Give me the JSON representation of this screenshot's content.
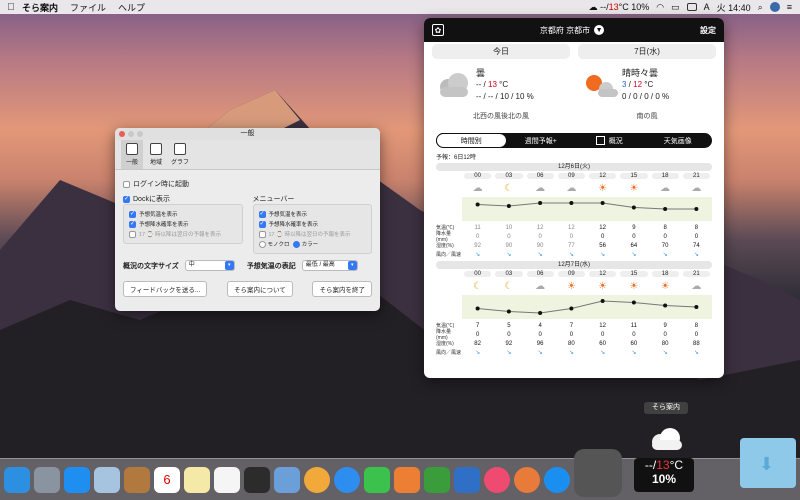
{
  "menubar": {
    "app_name": "そら案内",
    "menus": [
      "ファイル",
      "ヘルプ"
    ],
    "weather_status": "--/",
    "weather_temp": "13",
    "weather_unit": "°C",
    "weather_pop": "10%",
    "battery": "A",
    "clock": "火 14:40"
  },
  "popup": {
    "location": "京都府 京都市",
    "settings_label": "設定",
    "days": [
      {
        "label": "今日",
        "condition": "曇",
        "temps_hi": "13",
        "temps_lo": "--",
        "unit": "°C",
        "pop": "-- / -- / 10 / 10 %",
        "wind": "北西の風後北の風"
      },
      {
        "label": "7日(水)",
        "condition": "晴時々曇",
        "temps_hi": "12",
        "temps_lo": "3",
        "unit": "°C",
        "pop": "0 / 0 / 0 / 0 %",
        "wind": "南の風"
      }
    ],
    "tabs": [
      "時間別",
      "週間予報+",
      "概況",
      "天気画像"
    ],
    "forecast_label": "予報：6日12時",
    "days_hourly": [
      {
        "date": "12月6日(火)",
        "hours": [
          "00",
          "03",
          "06",
          "09",
          "12",
          "15",
          "18",
          "21"
        ],
        "temperature": [
          "11",
          "10",
          "12",
          "12",
          "12",
          "9",
          "8",
          "8"
        ],
        "precip": [
          "0",
          "0",
          "0",
          "0",
          "0",
          "0",
          "0",
          "0"
        ],
        "humidity": [
          "92",
          "90",
          "90",
          "77",
          "56",
          "64",
          "70",
          "74"
        ]
      },
      {
        "date": "12月7日(水)",
        "hours": [
          "00",
          "03",
          "06",
          "09",
          "12",
          "15",
          "18",
          "21"
        ],
        "temperature": [
          "7",
          "5",
          "4",
          "7",
          "12",
          "11",
          "9",
          "8"
        ],
        "precip": [
          "0",
          "0",
          "0",
          "0",
          "0",
          "0",
          "0",
          "0"
        ],
        "humidity": [
          "82",
          "92",
          "96",
          "80",
          "60",
          "60",
          "80",
          "88"
        ]
      }
    ],
    "row_labels": [
      "気温(℃)",
      "降水量(mm)",
      "湿度(%)",
      "風向／風速"
    ]
  },
  "prefs": {
    "title": "一般",
    "tabs": [
      "一般",
      "地域",
      "グラフ"
    ],
    "login_launch": "ログイン時に起動",
    "dock_label": "Dockに表示",
    "menubar_label": "メニューバー",
    "dock_items": [
      "予想気温を表示",
      "予想降水確率を表示",
      "17 ⌚ 時以降は翌日の予報を表示"
    ],
    "menu_items": [
      "予想気温を表示",
      "予想降水確率を表示",
      "17 ⌚ 時以降は翌日の予報を表示"
    ],
    "mono_label": "モノクロ",
    "color_label": "カラー",
    "font_size_label": "概況の文字サイズ",
    "font_size_value": "中",
    "temp_display_label": "予想気温の表記",
    "temp_display_value": "最低 / 最高",
    "buttons": [
      "フィードバックを送る...",
      "そら案内について",
      "そら案内を終了"
    ]
  },
  "dock": {
    "tooltip": "そら案内",
    "widget_temp": "--/",
    "widget_temp_value": "13",
    "widget_unit": "°C",
    "widget_pop": "10%",
    "calendar_day": "6"
  }
}
